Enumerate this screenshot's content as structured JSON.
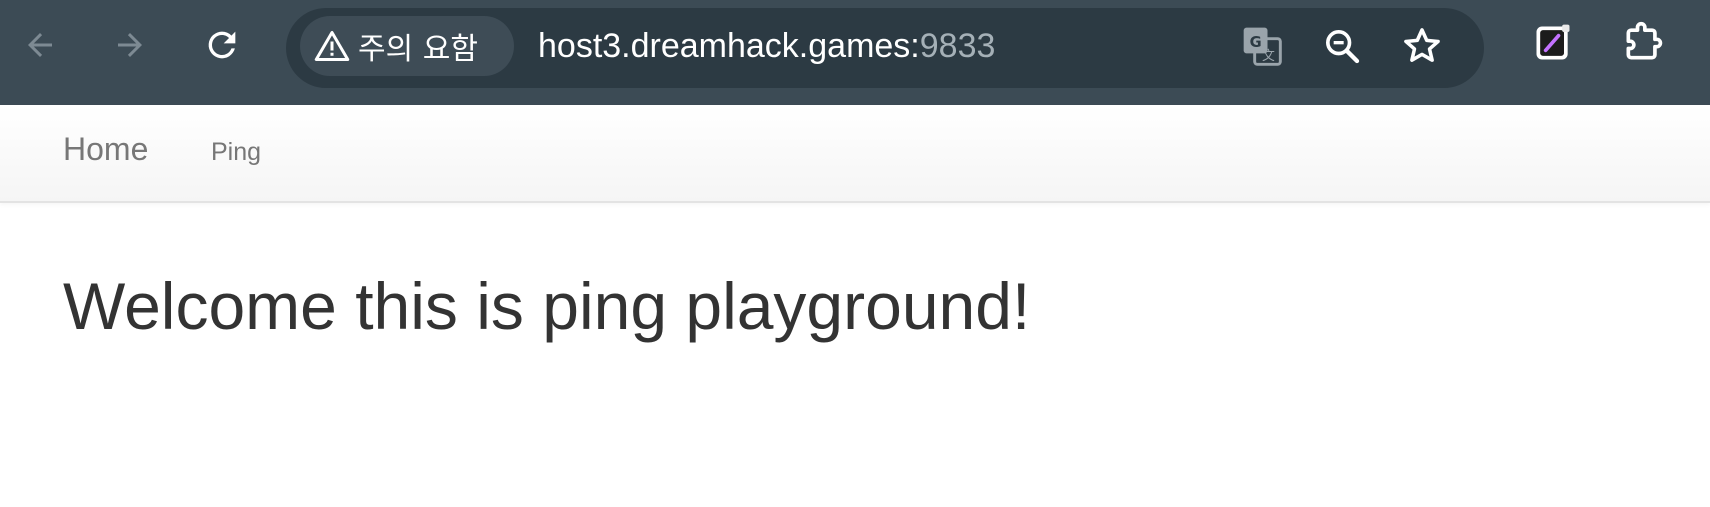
{
  "browser": {
    "security_chip_label": "주의 요함",
    "url_host": "host3.dreamhack.games:",
    "url_port": "9833",
    "icons": {
      "back": "arrow-left-icon",
      "forward": "arrow-right-icon",
      "reload": "reload-icon",
      "warning": "warning-triangle-icon",
      "translate": "translate-icon",
      "zoom": "zoom-out-icon",
      "bookmark": "star-icon",
      "extension_app": "notepad-extension-icon",
      "extensions": "puzzle-piece-icon"
    },
    "colors": {
      "toolbar": "#3c4b55",
      "omnibox": "#2c3a43",
      "chip": "#3e4c56"
    }
  },
  "navbar": {
    "brand": "Home",
    "links": [
      {
        "label": "Ping"
      }
    ]
  },
  "main": {
    "heading": "Welcome this is ping playground!"
  }
}
